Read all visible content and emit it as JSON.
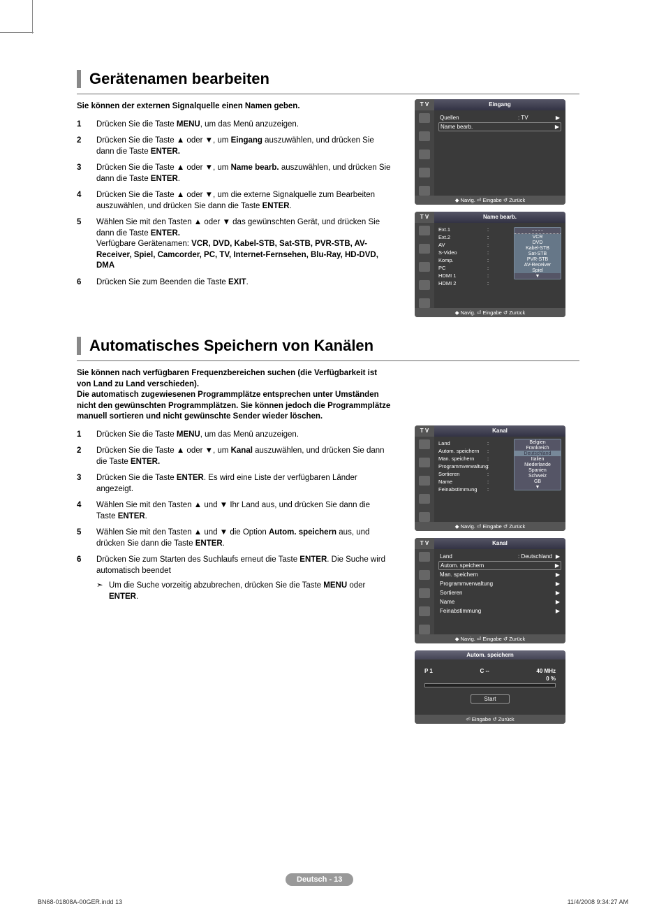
{
  "section1": {
    "heading": "Gerätenamen bearbeiten",
    "intro": "Sie können der externen Signalquelle einen Namen geben.",
    "steps": [
      {
        "num": "1",
        "body": "Drücken Sie die Taste <b>MENU</b>, um das Menü anzuzeigen."
      },
      {
        "num": "2",
        "body": "Drücken Sie die Taste ▲ oder ▼, um <b>Eingang</b> auszuwählen, und drücken Sie dann die Taste <b>ENTER.</b>"
      },
      {
        "num": "3",
        "body": "Drücken Sie die Taste ▲ oder ▼, um <b>Name bearb.</b> auszuwählen, und drücken Sie dann die Taste <b>ENTER</b>."
      },
      {
        "num": "4",
        "body": "Drücken Sie die Taste ▲ oder ▼, um die externe Signalquelle zum Bearbeiten auszuwählen, und drücken Sie dann die Taste <b>ENTER</b>."
      },
      {
        "num": "5",
        "body": "Wählen Sie mit den Tasten ▲ oder ▼ das gewünschten Gerät, und drücken Sie dann die Taste <b>ENTER.</b><br>Verfügbare Gerätenamen: <b>VCR, DVD, Kabel-STB, Sat-STB, PVR-STB, AV-Receiver, Spiel, Camcorder, PC, TV, Internet-Fernsehen, Blu-Ray, HD-DVD, DMA</b>"
      },
      {
        "num": "6",
        "body": "Drücken Sie zum Beenden die Taste <b>EXIT</b>."
      }
    ]
  },
  "section2": {
    "heading": "Automatisches Speichern von Kanälen",
    "intro": "Sie können nach verfügbaren Frequenzbereichen suchen (die Verfügbarkeit ist von Land zu Land verschieden).\nDie automatisch zugewiesenen Programmplätze entsprechen unter Umständen nicht den gewünschten Programmplätzen. Sie können jedoch die Programmplätze manuell sortieren und nicht gewünschte Sender wieder löschen.",
    "steps": [
      {
        "num": "1",
        "body": "Drücken Sie die Taste <b>MENU</b>, um das Menü anzuzeigen."
      },
      {
        "num": "2",
        "body": "Drücken Sie die Taste ▲ oder ▼, um <b>Kanal</b> auszuwählen, und drücken Sie dann die Taste <b>ENTER.</b>"
      },
      {
        "num": "3",
        "body": "Drücken Sie die Taste <b>ENTER</b>. Es wird eine Liste der verfügbaren Länder angezeigt."
      },
      {
        "num": "4",
        "body": "Wählen Sie mit den Tasten ▲ und ▼ Ihr Land aus, und drücken Sie dann die Taste <b>ENTER</b>."
      },
      {
        "num": "5",
        "body": "Wählen Sie mit den Tasten ▲ und ▼ die Option <b>Autom. speichern</b> aus, und drücken Sie dann die Taste <b>ENTER</b>."
      },
      {
        "num": "6",
        "body": "Drücken Sie zum Starten des Suchlaufs erneut die Taste <b>ENTER</b>. Die Suche wird automatisch beendet",
        "sub": "Um die Suche vorzeitig abzubrechen, drücken Sie die Taste <b>MENU</b> oder <b>ENTER</b>."
      }
    ]
  },
  "osd1": {
    "tv": "T V",
    "title": "Eingang",
    "rows": [
      {
        "label": "Quellen",
        "val": ": TV",
        "arrow": "▶"
      },
      {
        "label": "Name bearb.",
        "val": "",
        "arrow": "▶",
        "boxed": true
      }
    ],
    "footer": "◆ Navig.    ⏎ Eingabe   ↺ Zurück"
  },
  "osd2": {
    "tv": "T V",
    "title": "Name bearb.",
    "left": [
      "Ext.1",
      "Ext.2",
      "AV",
      "S-Video",
      "Komp.",
      "PC",
      "HDMI 1",
      "HDMI 2"
    ],
    "devices": [
      "- - - -",
      "VCR",
      "DVD",
      "Kabel-STB",
      "Sat-STB",
      "PVR-STB",
      "AV-Receiver",
      "Spiel",
      "▼"
    ],
    "footer": "◆ Navig.    ⏎ Eingabe   ↺ Zurück"
  },
  "osd3": {
    "tv": "T V",
    "title": "Kanal",
    "left": [
      "Land",
      "Autom. speichern",
      "Man. speichern",
      "Programmverwaltung",
      "Sortieren",
      "Name",
      "Feinabstimmung"
    ],
    "countries": [
      "Belgien",
      "Frankreich",
      "Deutschland",
      "Italien",
      "Niederlande",
      "Spanien",
      "Schweiz",
      "GB",
      "▼"
    ],
    "hl_index": 2,
    "footer": "◆ Navig.    ⏎ Eingabe   ↺ Zurück"
  },
  "osd4": {
    "tv": "T V",
    "title": "Kanal",
    "rows": [
      {
        "label": "Land",
        "val": ": Deutschland",
        "arrow": "▶"
      },
      {
        "label": "Autom. speichern",
        "val": "",
        "arrow": "▶",
        "boxed": true
      },
      {
        "label": "Man. speichern",
        "val": "",
        "arrow": "▶"
      },
      {
        "label": "Programmverwaltung",
        "val": "",
        "arrow": "▶"
      },
      {
        "label": "Sortieren",
        "val": "",
        "arrow": "▶"
      },
      {
        "label": "Name",
        "val": "",
        "arrow": "▶"
      },
      {
        "label": "Feinabstimmung",
        "val": "",
        "arrow": "▶"
      }
    ],
    "footer": "◆ Navig.    ⏎ Eingabe   ↺ Zurück"
  },
  "osd5": {
    "title": "Autom. speichern",
    "p": "P   1",
    "c": "C    --",
    "mhz": "40 MHz",
    "pct": "0  %",
    "start": "Start",
    "footer": "⏎ Eingabe        ↺ Zurück"
  },
  "page_label": "Deutsch - 13",
  "footer_left": "BN68-01808A-00GER.indd   13",
  "footer_right": "11/4/2008   9:34:27 AM"
}
